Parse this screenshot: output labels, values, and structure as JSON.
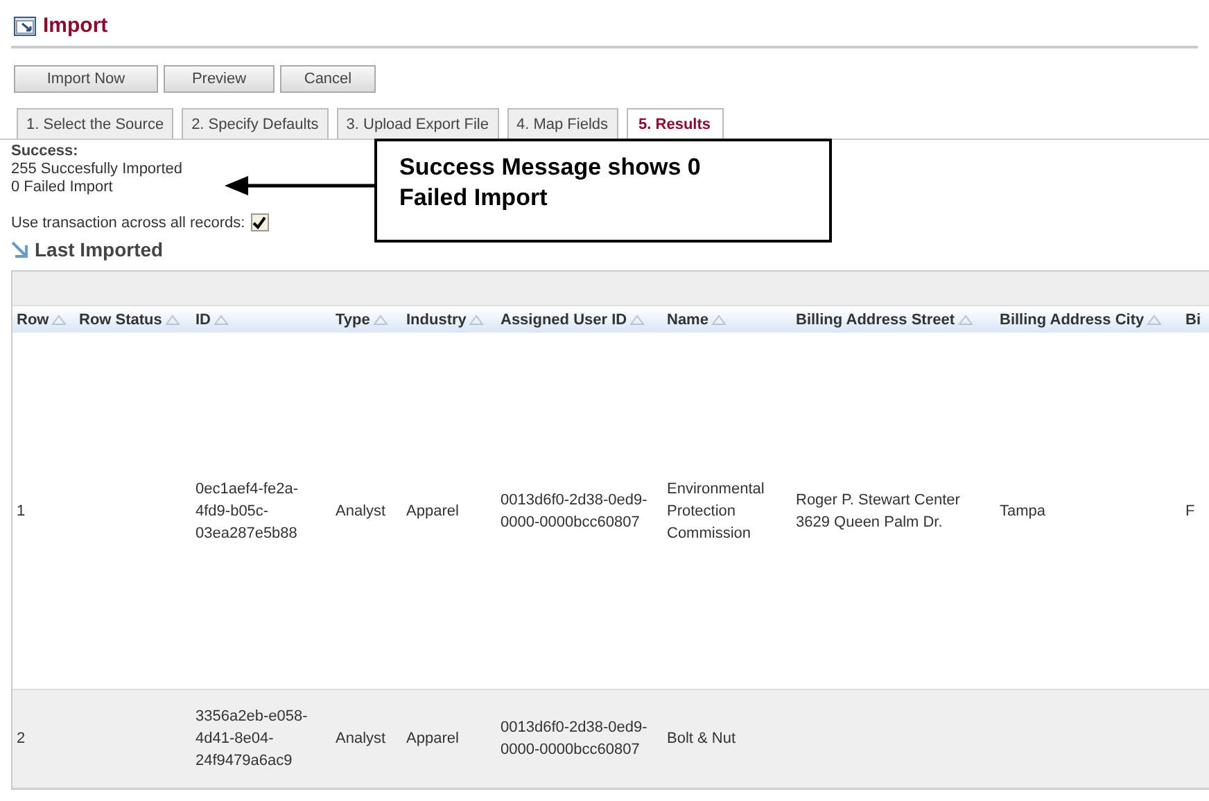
{
  "page": {
    "title": "Import"
  },
  "buttons": [
    "Import Now",
    "Preview",
    "Cancel"
  ],
  "tabs": [
    {
      "label": "1. Select the Source",
      "selected": false
    },
    {
      "label": "2. Specify Defaults",
      "selected": false
    },
    {
      "label": "3. Upload Export File",
      "selected": false
    },
    {
      "label": "4. Map Fields",
      "selected": false
    },
    {
      "label": "5. Results",
      "selected": true
    }
  ],
  "result": {
    "heading": "Success:",
    "lines": [
      "255 Succesfully Imported",
      "0 Failed Import"
    ]
  },
  "transaction_option": {
    "label": "Use transaction across all records:",
    "checked": true
  },
  "callout": {
    "text": "Success Message shows 0 Failed Import"
  },
  "section": {
    "title": "Last Imported"
  },
  "table": {
    "columns": [
      {
        "label": "Row",
        "sortable": true
      },
      {
        "label": "Row Status",
        "sortable": true
      },
      {
        "label": "ID",
        "sortable": true
      },
      {
        "label": "Type",
        "sortable": true
      },
      {
        "label": "Industry",
        "sortable": true
      },
      {
        "label": "Assigned User ID",
        "sortable": true
      },
      {
        "label": "Name",
        "sortable": true
      },
      {
        "label": "Billing Address Street",
        "sortable": true
      },
      {
        "label": "Billing Address City",
        "sortable": true
      },
      {
        "label": "Bi",
        "sortable": false
      }
    ],
    "rows": [
      {
        "cells": [
          "1",
          "",
          "0ec1aef4-fe2a-4fd9-b05c-03ea287e5b88",
          "Analyst",
          "Apparel",
          "0013d6f0-2d38-0ed9-0000-0000bcc60807",
          "Environmental Protection Commission",
          "Roger P. Stewart Center 3629 Queen Palm Dr.",
          "Tampa",
          "F"
        ]
      },
      {
        "cells": [
          "2",
          "",
          "3356a2eb-e058-4d41-8e04-24f9479a6ac9",
          "Analyst",
          "Apparel",
          "0013d6f0-2d38-0ed9-0000-0000bcc60807",
          "Bolt & Nut",
          "",
          "",
          ""
        ]
      }
    ]
  }
}
